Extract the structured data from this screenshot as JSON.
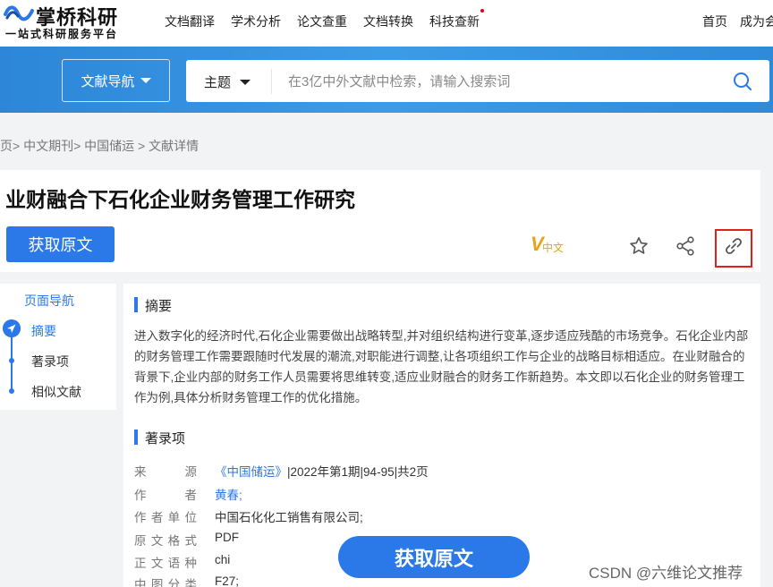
{
  "header": {
    "brand": "掌桥科研",
    "tagline": "一站式科研服务平台",
    "nav": [
      "文档翻译",
      "学术分析",
      "论文查重",
      "文档转换",
      "科技查新"
    ],
    "right_links": [
      "首页",
      "成为会"
    ]
  },
  "search": {
    "nav_label": "文献导航",
    "type_label": "主题",
    "placeholder": "在3亿中外文献中检索，请输入搜索词"
  },
  "breadcrumb": "页> 中文期刊> 中国储运 > 文献详情",
  "article": {
    "title": "业财融合下石化企业财务管理工作研究",
    "get_button": "获取原文",
    "lang_badge_v": "V",
    "lang_badge_text": "中文"
  },
  "sidenav": {
    "heading": "页面导航",
    "items": [
      "摘要",
      "著录项",
      "相似文献"
    ]
  },
  "sections": {
    "abstract_title": "摘要",
    "abstract_text": "进入数字化的经济时代,石化企业需要做出战略转型,并对组织结构进行变革,逐步适应残酷的市场竞争。石化企业内部的财务管理工作需要跟随时代发展的潮流,对职能进行调整,让各项组织工作与企业的战略目标相适应。在业财融合的背景下,企业内部的财务工作人员需要将思维转变,适应业财融合的财务工作新趋势。本文即以石化企业的财务管理工作为例,具体分析财务管理工作的优化措施。",
    "meta_title": "著录项"
  },
  "meta": [
    {
      "key": "来源",
      "link": "《中国储运》",
      "rest": "|2022年第1期|94-95|共2页"
    },
    {
      "key": "作者",
      "link": "黄春;",
      "rest": ""
    },
    {
      "key": "作者单位",
      "link": "",
      "rest": "中国石化化工销售有限公司;"
    },
    {
      "key": "原文格式",
      "link": "",
      "rest": "PDF"
    },
    {
      "key": "正文语种",
      "link": "",
      "rest": "chi"
    },
    {
      "key": "中图分类",
      "link": "",
      "rest": "F27;"
    }
  ],
  "float_button": "获取原文",
  "watermark": "CSDN @六维论文推荐",
  "colors": {
    "accent": "#2b79e8",
    "highlight_box": "#e0201b",
    "badge": "#e8a317"
  }
}
